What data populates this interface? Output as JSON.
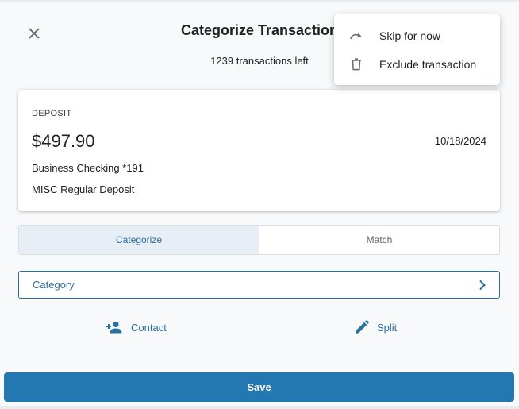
{
  "dialog": {
    "title": "Categorize Transaction",
    "subtitle": "1239 transactions left"
  },
  "transaction": {
    "type": "DEPOSIT",
    "amount": "$497.90",
    "date": "10/18/2024",
    "account": "Business Checking *191",
    "description": "MISC Regular Deposit"
  },
  "tabs": [
    {
      "label": "Categorize",
      "active": true
    },
    {
      "label": "Match",
      "active": false
    }
  ],
  "category_field": {
    "label": "Category"
  },
  "actions": {
    "contact_label": "Contact",
    "split_label": "Split"
  },
  "save_label": "Save",
  "menu": {
    "items": [
      {
        "label": "Skip for now",
        "icon": "redo-icon"
      },
      {
        "label": "Exclude transaction",
        "icon": "trash-icon"
      }
    ]
  },
  "colors": {
    "accent": "#2b6f9d",
    "save_button": "#2478b1",
    "background": "#f7f9fb",
    "active_tab": "#e8eef5"
  }
}
